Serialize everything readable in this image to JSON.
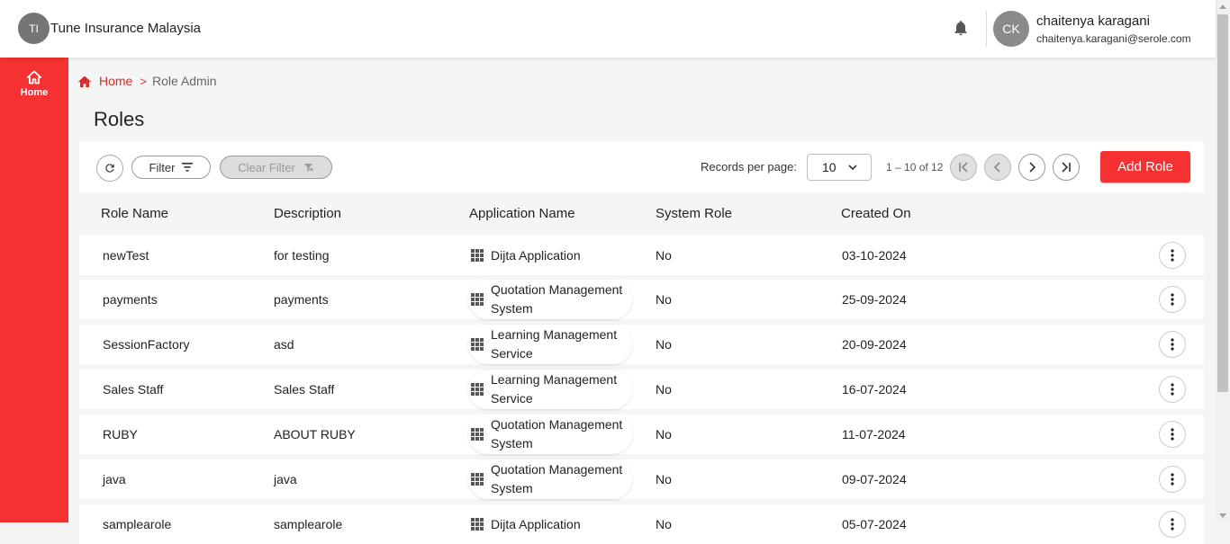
{
  "header": {
    "org_initials": "TI",
    "org_name": "Tune Insurance Malaysia",
    "user_initials": "CK",
    "user_name": "chaitenya karagani",
    "user_email": "chaitenya.karagani@serole.com"
  },
  "sidebar": {
    "items": [
      {
        "label": "Home",
        "icon": "home-icon"
      }
    ]
  },
  "breadcrumb": {
    "home": "Home",
    "separator": ">",
    "current": "Role Admin"
  },
  "page": {
    "title": "Roles"
  },
  "toolbar": {
    "filter_label": "Filter",
    "clear_filter_label": "Clear Filter",
    "records_per_page_label": "Records per page:",
    "records_per_page_value": "10",
    "range_text": "1 – 10 of 12",
    "add_label": "Add Role"
  },
  "table": {
    "columns": [
      "Role Name",
      "Description",
      "Application Name",
      "System Role",
      "Created On"
    ],
    "rows": [
      {
        "role": "newTest",
        "description": "for testing",
        "app": "Dijta Application",
        "system": "No",
        "created": "03-10-2024"
      },
      {
        "role": "payments",
        "description": "payments",
        "app": "Quotation Management System",
        "system": "No",
        "created": "25-09-2024"
      },
      {
        "role": "SessionFactory",
        "description": "asd",
        "app": "Learning Management Service",
        "system": "No",
        "created": "20-09-2024"
      },
      {
        "role": "Sales Staff",
        "description": "Sales Staff",
        "app": "Learning Management Service",
        "system": "No",
        "created": "16-07-2024"
      },
      {
        "role": "RUBY",
        "description": "ABOUT RUBY",
        "app": "Quotation Management System",
        "system": "No",
        "created": "11-07-2024"
      },
      {
        "role": "java",
        "description": "java",
        "app": "Quotation Management System",
        "system": "No",
        "created": "09-07-2024"
      },
      {
        "role": "samplearole",
        "description": "samplearole",
        "app": "Dijta Application",
        "system": "No",
        "created": "05-07-2024"
      }
    ]
  },
  "colors": {
    "accent": "#f53131",
    "breadcrumb": "#d32f2f"
  }
}
